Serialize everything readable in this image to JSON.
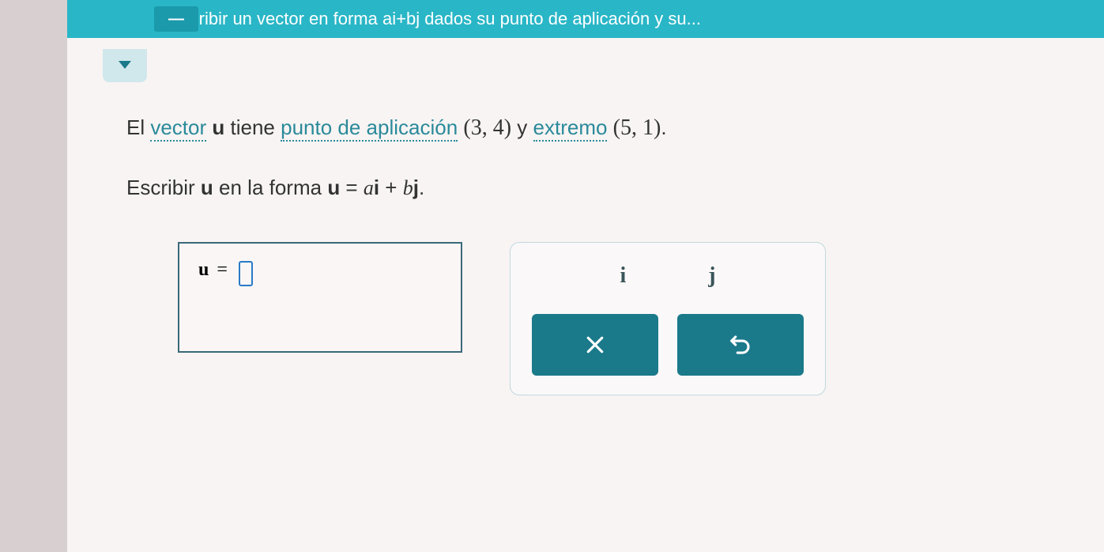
{
  "header": {
    "title": "Escribir un vector en forma ai+bj dados su punto de aplicación y su..."
  },
  "problem": {
    "t1": "El ",
    "term_vector": "vector",
    "t2": " ",
    "u": "u",
    "t3": " tiene ",
    "term_punto": "punto de aplicación",
    "t4": " ",
    "point1": "(3, 4)",
    "t5": " y ",
    "term_extremo": "extremo",
    "t6": " ",
    "point2": "(5, 1)",
    "t7": ".",
    "line2a": "Escribir ",
    "line2b": " en la forma ",
    "line2c": " = ",
    "a": "a",
    "i": "i",
    "plus": " + ",
    "b": "b",
    "j": "j",
    "period": "."
  },
  "answer": {
    "label": "u",
    "equals": "="
  },
  "keypad": {
    "i": "i",
    "j": "j"
  }
}
